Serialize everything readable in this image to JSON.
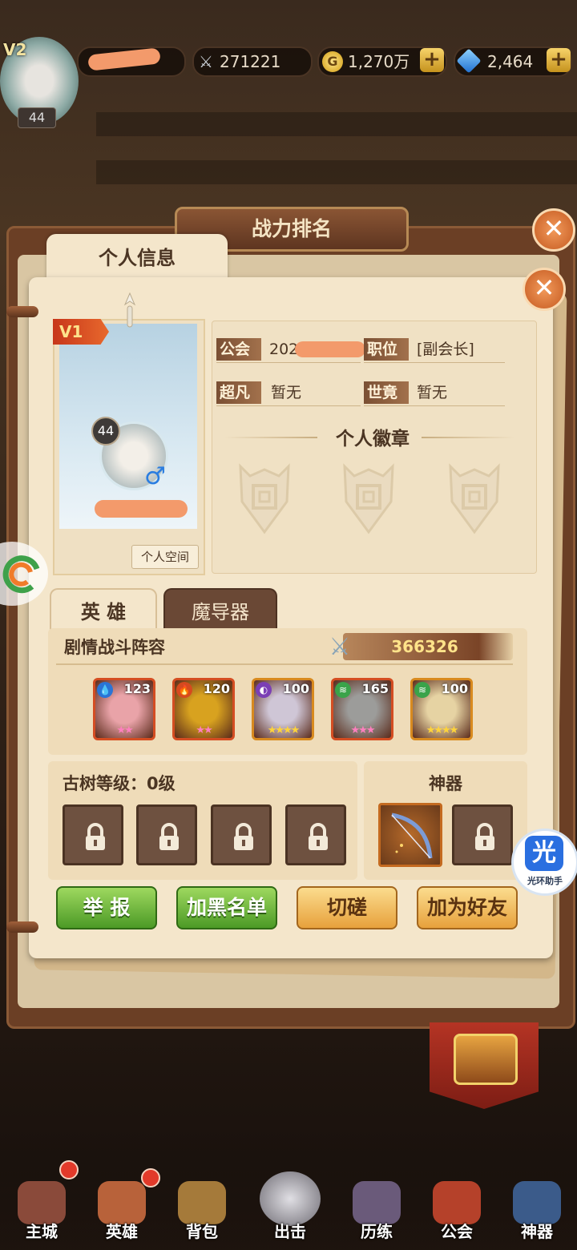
{
  "top_bar": {
    "vip": "V2",
    "level": "44",
    "power": "271221",
    "gold": "1,270万",
    "diamonds": "2,464"
  },
  "window": {
    "title": "战力排名",
    "tab": "个人信息"
  },
  "profile": {
    "vip": "V1",
    "level": "44",
    "space_button": "个人空间",
    "guild_label": "公会",
    "guild_value": "202",
    "position_label": "职位",
    "position_value": "[副会长]",
    "chaofan_label": "超凡",
    "chaofan_value": "暂无",
    "shijing_label": "世竟",
    "shijing_value": "暂无",
    "badges_title": "个人徽章"
  },
  "hero_tabs": [
    "英 雄",
    "魔导器"
  ],
  "team": {
    "title": "剧情战斗阵容",
    "power": "366326",
    "heroes": [
      {
        "level": "123",
        "element": "water",
        "stars": "★★",
        "color": "#e9a3a8"
      },
      {
        "level": "120",
        "element": "fire",
        "stars": "★★",
        "color": "#d8a21f"
      },
      {
        "level": "100",
        "element": "dark",
        "stars": "★★★★",
        "color": "#cfc6d6"
      },
      {
        "level": "165",
        "element": "wind",
        "stars": "★★★",
        "color": "#9c9c9a"
      },
      {
        "level": "100",
        "element": "wind",
        "stars": "★★★★",
        "color": "#e6d3a3"
      }
    ]
  },
  "tree": {
    "title": "古树等级：0级"
  },
  "artifact": {
    "title": "神器"
  },
  "buttons": {
    "report": "举 报",
    "blacklist": "加黑名单",
    "spar": "切磋",
    "add_friend": "加为好友"
  },
  "assistant": {
    "glyph": "光",
    "label": "光环助手"
  },
  "nav": [
    "主城",
    "英雄",
    "背包",
    "出击",
    "历练",
    "公会",
    "神器"
  ]
}
